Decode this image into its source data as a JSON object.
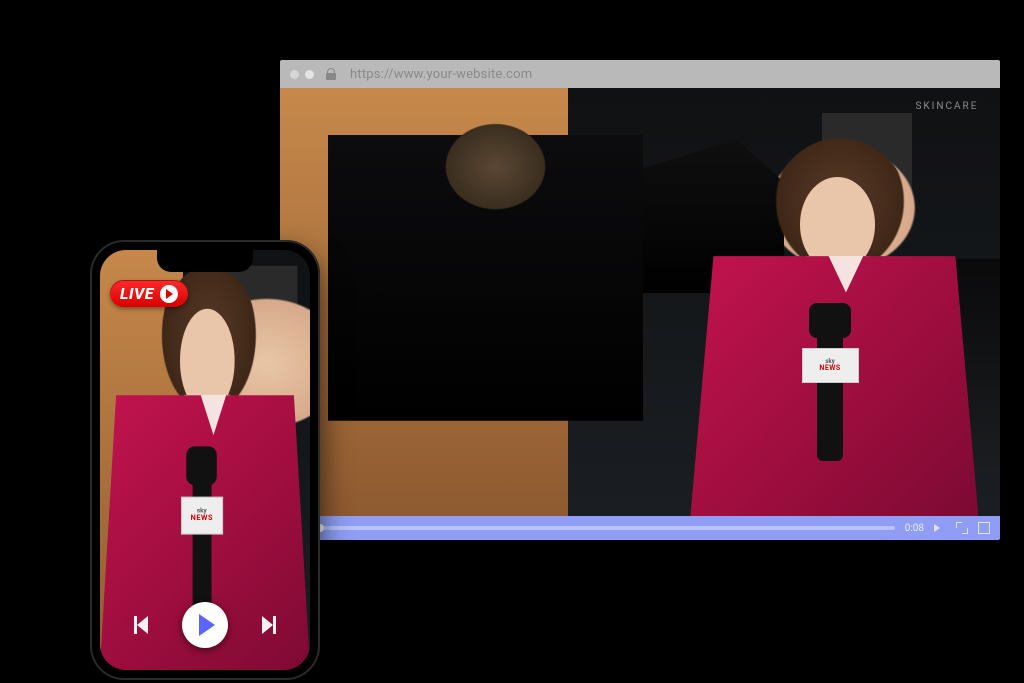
{
  "browser": {
    "url": "https://www.your-website.com",
    "sign_text": "SKINCARE"
  },
  "mic": {
    "brand_top": "sky",
    "brand_bottom": "NEWS"
  },
  "player": {
    "time_elapsed": "0:08",
    "progress_percent": 2
  },
  "phone": {
    "live_label": "LIVE"
  },
  "colors": {
    "accent_player": "#8f9ef4",
    "accent_play_triangle": "#5a66ff",
    "live_red": "#d80000",
    "jacket": "#c3134e"
  }
}
